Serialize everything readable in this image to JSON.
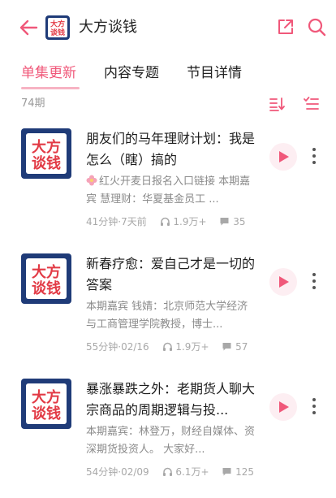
{
  "header": {
    "podcast_title": "大方谈钱",
    "logo_text_line1": "大方",
    "logo_text_line2": "谈钱"
  },
  "tabs": [
    {
      "label": "单集更新",
      "active": true
    },
    {
      "label": "内容专题",
      "active": false
    },
    {
      "label": "节目详情",
      "active": false
    }
  ],
  "episode_count": "74期",
  "episodes": [
    {
      "title": "朋友们的马年理财计划：我是怎么（瞎）搞的",
      "description": "红火开麦日报名入口链接 本期嘉宾 慧理财：华夏基金员工 ...",
      "duration": "41分钟",
      "date": "7天前",
      "plays": "1.9万+",
      "comments": "35",
      "has_flower_icon": true
    },
    {
      "title": "新春疗愈：爱自己才是一切的答案",
      "description": "本期嘉宾 钱婧：北京师范大学经济与工商管理学院教授，博士...",
      "duration": "55分钟",
      "date": "02/16",
      "plays": "1.9万+",
      "comments": "57",
      "has_flower_icon": false
    },
    {
      "title": "暴涨暴跌之外：老期货人聊大宗商品的周期逻辑与投...",
      "description": "本期嘉宾：林登万，财经自媒体、资深期货投资人。 大家好...",
      "duration": "54分钟",
      "date": "02/09",
      "plays": "6.1万+",
      "comments": "125",
      "has_flower_icon": false
    }
  ],
  "colors": {
    "accent": "#f0587a",
    "cover_blue": "#1f3b78",
    "cover_red": "#e23a45"
  }
}
